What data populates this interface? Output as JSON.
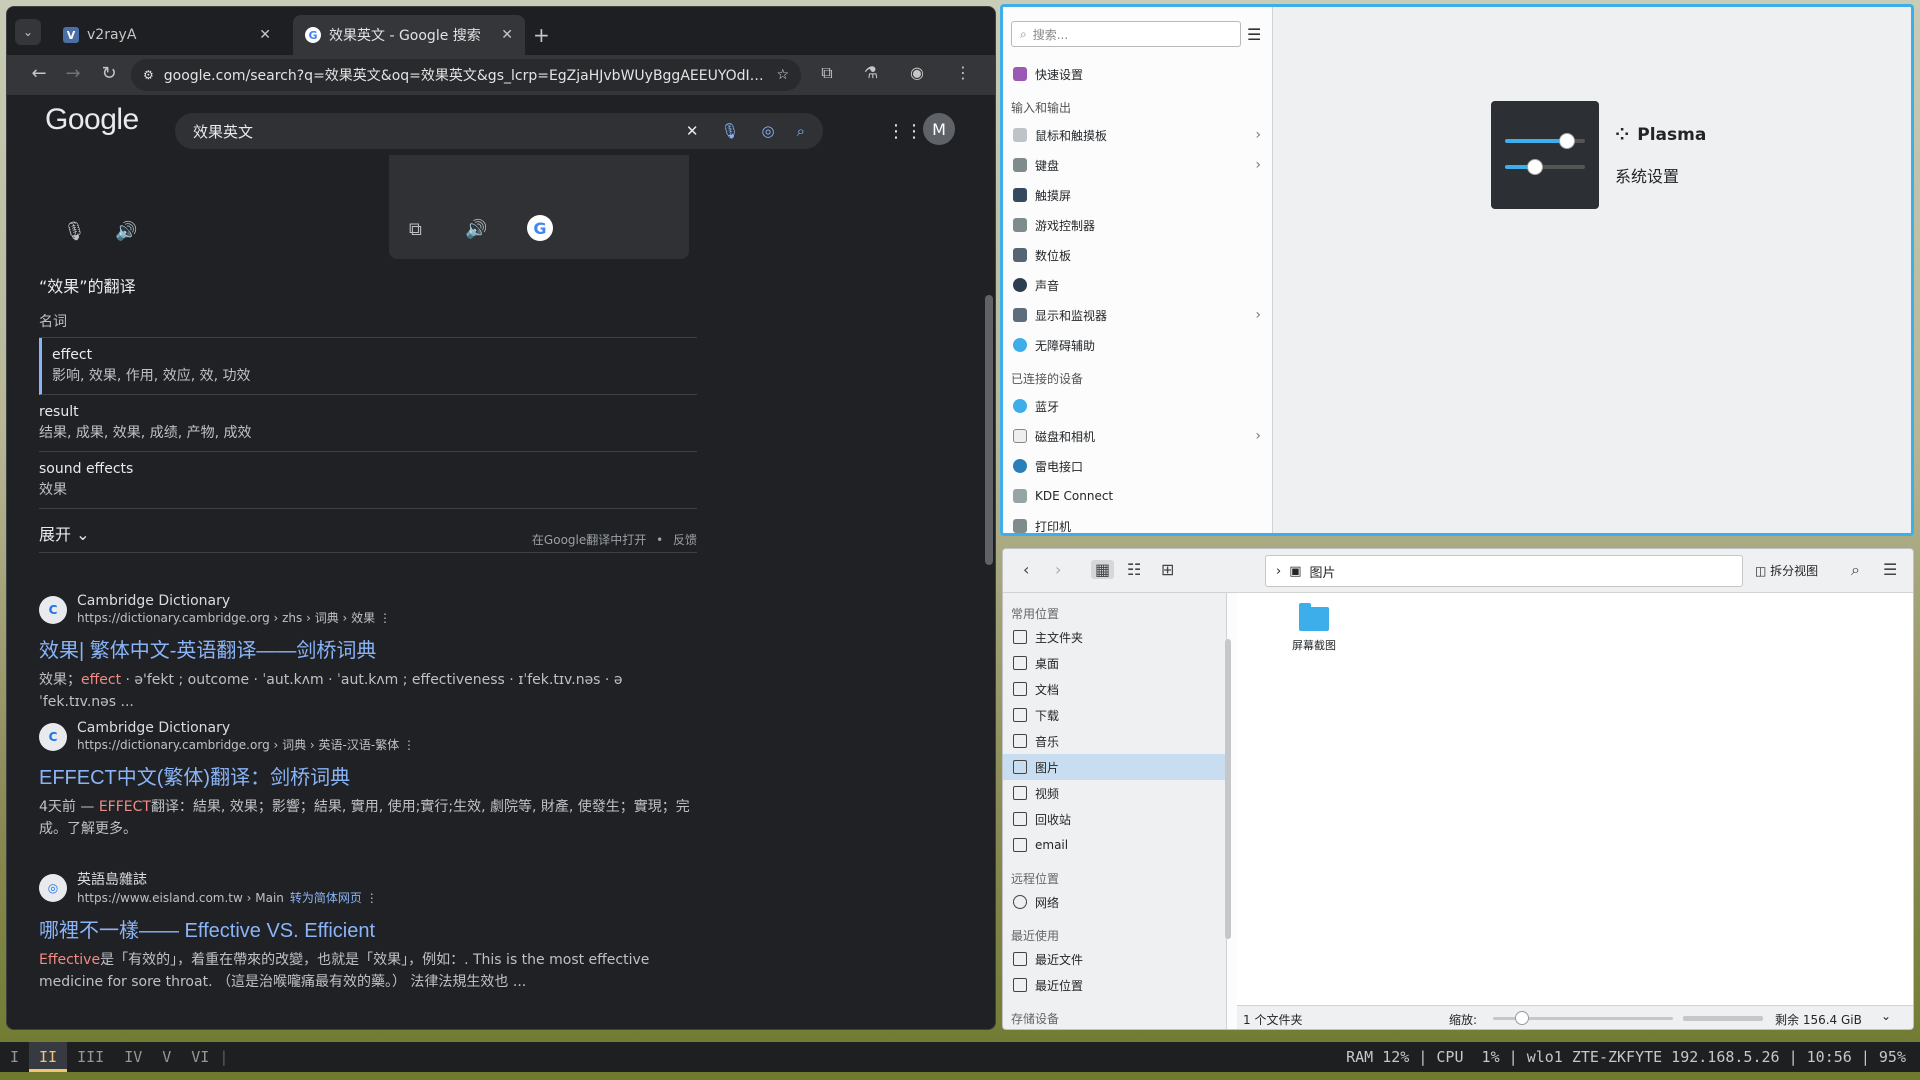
{
  "chrome": {
    "tabs": [
      {
        "title": "v2rayA",
        "icon": "v2raya-icon"
      },
      {
        "title": "效果英文 - Google 搜索",
        "icon": "google-icon"
      }
    ],
    "url": "google.com/search?q=效果英文&oq=效果英文&gs_lcrp=EgZjaHJvbWUyBggAEEUYOdIBC..."
  },
  "google": {
    "logo": "Google",
    "query": "效果英文",
    "avatar_letter": "M",
    "dict": {
      "title": "“效果”的翻译",
      "pos": "名词",
      "entries": [
        {
          "word": "effect",
          "trans": "影响, 效果, 作用, 效应, 效, 功效"
        },
        {
          "word": "result",
          "trans": "结果, 成果, 效果, 成绩, 产物, 成效"
        },
        {
          "word": "sound effects",
          "trans": "效果"
        }
      ],
      "expand": "展开",
      "open_translate": "在Google翻译中打开",
      "dot": "•",
      "feedback": "反馈"
    },
    "results": [
      {
        "site": "Cambridge Dictionary",
        "url": "https://dictionary.cambridge.org › zhs › 词典 › 效果",
        "title": "效果| 繁体中文-英语翻译——剑桥词典",
        "snippet_pre": "效果；",
        "snippet_hl": "effect",
        "snippet_post": " · ə'fekt ; outcome · ˈaut.kʌm · ˈaut.kʌm ; effectiveness · ɪˈfek.tɪv.nəs · əˈfek.tɪv.nəs ..."
      },
      {
        "site": "Cambridge Dictionary",
        "url": "https://dictionary.cambridge.org › 词典 › 英语-汉语-繁体",
        "title": "EFFECT中文(繁体)翻译：剑桥词典",
        "snippet_pre": "4天前 — ",
        "snippet_hl": "EFFECT",
        "snippet_post": "翻译：結果, 效果；影響；結果, 實用, 使用;實行;生效, 劇院等, 財產, 使發生；實現；完成。了解更多。"
      },
      {
        "site": "英語島雜誌",
        "url": "https://www.eisland.com.tw › Main",
        "url_extra": "转为简体网页",
        "title": "哪裡不一樣—— Effective VS. Efficient",
        "snippet_pre": "",
        "snippet_hl": "Effective",
        "snippet_post": "是「有效的」，着重在帶來的改變，也就是「效果」，例如：. This is the most effective medicine for sore throat. （這是治喉嚨痛最有效的藥。） 法律法規生效也 ..."
      }
    ]
  },
  "settings": {
    "search_placeholder": "搜索...",
    "quick": "快速设置",
    "cat_io": "输入和输出",
    "io_items": [
      "鼠标和触摸板",
      "键盘",
      "触摸屏",
      "游戏控制器",
      "数位板",
      "声音",
      "显示和监视器",
      "无障碍辅助"
    ],
    "cat_devices": "已连接的设备",
    "device_items": [
      "蓝牙",
      "磁盘和相机",
      "雷电接口",
      "KDE Connect",
      "打印机"
    ],
    "plasma_name": "Plasma",
    "plasma_sub": "系统设置"
  },
  "dolphin": {
    "crumb": "图片",
    "split": "拆分视图",
    "cat_places": "常用位置",
    "places": [
      "主文件夹",
      "桌面",
      "文档",
      "下载",
      "音乐",
      "图片",
      "视频",
      "回收站",
      "email"
    ],
    "cat_remote": "远程位置",
    "remote": [
      "网络"
    ],
    "cat_recent": "最近使用",
    "recent": [
      "最近文件",
      "最近位置"
    ],
    "cat_storage": "存储设备",
    "folder": "屏幕截图",
    "status_count": "1 个文件夹",
    "zoom_label": "缩放:",
    "free": "剩余 156.4 GiB"
  },
  "statusbar": {
    "workspaces": [
      "I",
      "II",
      "III",
      "IV",
      "V",
      "VI"
    ],
    "active_ws": "II",
    "info": "RAM 12% | CPU  1% | wlo1 ZTE-ZKFYTE 192.168.5.26 | 10:56 | 95%"
  }
}
